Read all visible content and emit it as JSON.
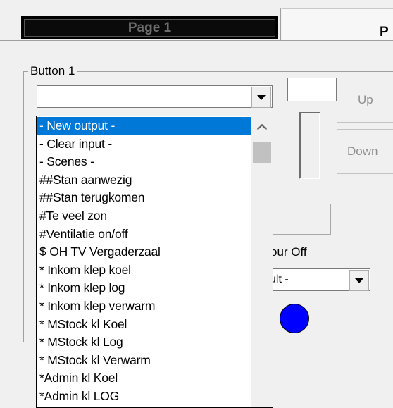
{
  "tabs": [
    {
      "label": "Page 1",
      "active": true
    },
    {
      "label": "P",
      "active": false
    }
  ],
  "group": {
    "label": "Button 1"
  },
  "combo": {
    "value": ""
  },
  "controls": {
    "up_label": "Up",
    "down_label": "Down",
    "colour_label": "our Off",
    "colour_combo_value": "ult -",
    "circle_color": "#0000ff"
  },
  "dropdown": {
    "selected_index": 0,
    "items": [
      "- New output -",
      "- Clear input -",
      "- Scenes -",
      "##Stan aanwezig",
      "##Stan terugkomen",
      "#Te veel zon",
      "#Ventilatie on/off",
      "$ OH TV Vergaderzaal",
      "* Inkom klep koel",
      "* Inkom klep log",
      "* Inkom klep verwarm",
      "* MStock kl Koel",
      "* MStock kl Log",
      "* MStock kl Verwarm",
      "*Admin kl Koel",
      "*Admin kl LOG"
    ]
  },
  "colors": {
    "selection": "#0078d7",
    "circle": "#0000ff"
  }
}
